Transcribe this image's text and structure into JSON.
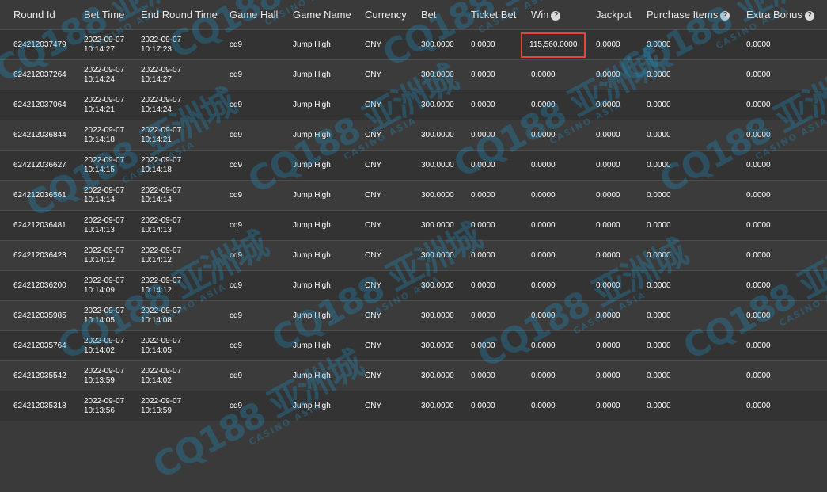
{
  "columns": [
    {
      "label": "Round Id",
      "help": false
    },
    {
      "label": "Bet Time",
      "help": false
    },
    {
      "label": "End Round Time",
      "help": false
    },
    {
      "label": "Game Hall",
      "help": false
    },
    {
      "label": "Game Name",
      "help": false
    },
    {
      "label": "Currency",
      "help": false
    },
    {
      "label": "Bet",
      "help": false
    },
    {
      "label": "Ticket Bet",
      "help": false
    },
    {
      "label": "Win",
      "help": true
    },
    {
      "label": "Jackpot",
      "help": false
    },
    {
      "label": "Purchase Items",
      "help": true
    },
    {
      "label": "Extra Bonus",
      "help": true
    }
  ],
  "help_glyph": "?",
  "rows": [
    {
      "round_id": "624212037479",
      "bet_date": "2022-09-07",
      "bet_time": "10:14:27",
      "end_date": "2022-09-07",
      "end_time": "10:17:23",
      "game_hall": "cq9",
      "game_name": "Jump High",
      "currency": "CNY",
      "bet": "300.0000",
      "ticket_bet": "0.0000",
      "win": "115,560.0000",
      "jackpot": "0.0000",
      "purchase_items": "0.0000",
      "extra_bonus": "0.0000",
      "highlight": true
    },
    {
      "round_id": "624212037264",
      "bet_date": "2022-09-07",
      "bet_time": "10:14:24",
      "end_date": "2022-09-07",
      "end_time": "10:14:27",
      "game_hall": "cq9",
      "game_name": "Jump High",
      "currency": "CNY",
      "bet": "300.0000",
      "ticket_bet": "0.0000",
      "win": "0.0000",
      "jackpot": "0.0000",
      "purchase_items": "0.0000",
      "extra_bonus": "0.0000",
      "highlight": false
    },
    {
      "round_id": "624212037064",
      "bet_date": "2022-09-07",
      "bet_time": "10:14:21",
      "end_date": "2022-09-07",
      "end_time": "10:14:24",
      "game_hall": "cq9",
      "game_name": "Jump High",
      "currency": "CNY",
      "bet": "300.0000",
      "ticket_bet": "0.0000",
      "win": "0.0000",
      "jackpot": "0.0000",
      "purchase_items": "0.0000",
      "extra_bonus": "0.0000",
      "highlight": false
    },
    {
      "round_id": "624212036844",
      "bet_date": "2022-09-07",
      "bet_time": "10:14:18",
      "end_date": "2022-09-07",
      "end_time": "10:14:21",
      "game_hall": "cq9",
      "game_name": "Jump High",
      "currency": "CNY",
      "bet": "300.0000",
      "ticket_bet": "0.0000",
      "win": "0.0000",
      "jackpot": "0.0000",
      "purchase_items": "0.0000",
      "extra_bonus": "0.0000",
      "highlight": false
    },
    {
      "round_id": "624212036627",
      "bet_date": "2022-09-07",
      "bet_time": "10:14:15",
      "end_date": "2022-09-07",
      "end_time": "10:14:18",
      "game_hall": "cq9",
      "game_name": "Jump High",
      "currency": "CNY",
      "bet": "300.0000",
      "ticket_bet": "0.0000",
      "win": "0.0000",
      "jackpot": "0.0000",
      "purchase_items": "0.0000",
      "extra_bonus": "0.0000",
      "highlight": false
    },
    {
      "round_id": "624212036561",
      "bet_date": "2022-09-07",
      "bet_time": "10:14:14",
      "end_date": "2022-09-07",
      "end_time": "10:14:14",
      "game_hall": "cq9",
      "game_name": "Jump High",
      "currency": "CNY",
      "bet": "300.0000",
      "ticket_bet": "0.0000",
      "win": "0.0000",
      "jackpot": "0.0000",
      "purchase_items": "0.0000",
      "extra_bonus": "0.0000",
      "highlight": false
    },
    {
      "round_id": "624212036481",
      "bet_date": "2022-09-07",
      "bet_time": "10:14:13",
      "end_date": "2022-09-07",
      "end_time": "10:14:13",
      "game_hall": "cq9",
      "game_name": "Jump High",
      "currency": "CNY",
      "bet": "300.0000",
      "ticket_bet": "0.0000",
      "win": "0.0000",
      "jackpot": "0.0000",
      "purchase_items": "0.0000",
      "extra_bonus": "0.0000",
      "highlight": false
    },
    {
      "round_id": "624212036423",
      "bet_date": "2022-09-07",
      "bet_time": "10:14:12",
      "end_date": "2022-09-07",
      "end_time": "10:14:12",
      "game_hall": "cq9",
      "game_name": "Jump High",
      "currency": "CNY",
      "bet": "300.0000",
      "ticket_bet": "0.0000",
      "win": "0.0000",
      "jackpot": "0.0000",
      "purchase_items": "0.0000",
      "extra_bonus": "0.0000",
      "highlight": false
    },
    {
      "round_id": "624212036200",
      "bet_date": "2022-09-07",
      "bet_time": "10:14:09",
      "end_date": "2022-09-07",
      "end_time": "10:14:12",
      "game_hall": "cq9",
      "game_name": "Jump High",
      "currency": "CNY",
      "bet": "300.0000",
      "ticket_bet": "0.0000",
      "win": "0.0000",
      "jackpot": "0.0000",
      "purchase_items": "0.0000",
      "extra_bonus": "0.0000",
      "highlight": false
    },
    {
      "round_id": "624212035985",
      "bet_date": "2022-09-07",
      "bet_time": "10:14:05",
      "end_date": "2022-09-07",
      "end_time": "10:14:08",
      "game_hall": "cq9",
      "game_name": "Jump High",
      "currency": "CNY",
      "bet": "300.0000",
      "ticket_bet": "0.0000",
      "win": "0.0000",
      "jackpot": "0.0000",
      "purchase_items": "0.0000",
      "extra_bonus": "0.0000",
      "highlight": false
    },
    {
      "round_id": "624212035764",
      "bet_date": "2022-09-07",
      "bet_time": "10:14:02",
      "end_date": "2022-09-07",
      "end_time": "10:14:05",
      "game_hall": "cq9",
      "game_name": "Jump High",
      "currency": "CNY",
      "bet": "300.0000",
      "ticket_bet": "0.0000",
      "win": "0.0000",
      "jackpot": "0.0000",
      "purchase_items": "0.0000",
      "extra_bonus": "0.0000",
      "highlight": false
    },
    {
      "round_id": "624212035542",
      "bet_date": "2022-09-07",
      "bet_time": "10:13:59",
      "end_date": "2022-09-07",
      "end_time": "10:14:02",
      "game_hall": "cq9",
      "game_name": "Jump High",
      "currency": "CNY",
      "bet": "300.0000",
      "ticket_bet": "0.0000",
      "win": "0.0000",
      "jackpot": "0.0000",
      "purchase_items": "0.0000",
      "extra_bonus": "0.0000",
      "highlight": false
    },
    {
      "round_id": "624212035318",
      "bet_date": "2022-09-07",
      "bet_time": "10:13:56",
      "end_date": "2022-09-07",
      "end_time": "10:13:59",
      "game_hall": "cq9",
      "game_name": "Jump High",
      "currency": "CNY",
      "bet": "300.0000",
      "ticket_bet": "0.0000",
      "win": "0.0000",
      "jackpot": "0.0000",
      "purchase_items": "0.0000",
      "extra_bonus": "0.0000",
      "highlight": false
    }
  ],
  "watermark": {
    "main": "CQ188 亚洲城",
    "sub": "CASINO ASIA",
    "color": "#1e9bd7"
  },
  "colors": {
    "background": "#3a3a3a",
    "highlight_border": "#e0473d"
  }
}
